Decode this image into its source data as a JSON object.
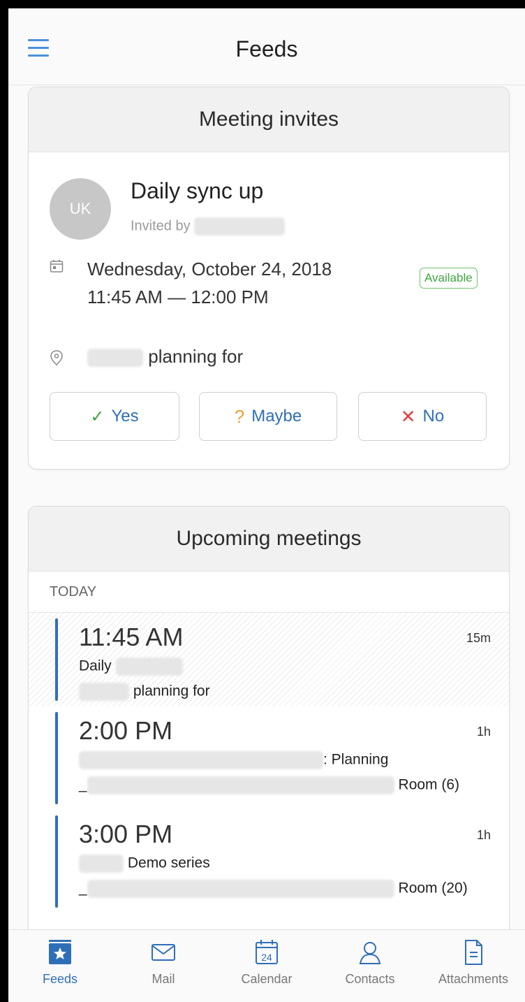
{
  "header": {
    "title": "Feeds"
  },
  "invites": {
    "section_title": "Meeting invites",
    "avatar_initials": "UK",
    "title": "Daily sync up",
    "invited_by": "Invited by",
    "date_line": "Wednesday, October 24, 2018",
    "time_line": "11:45 AM — 12:00 PM",
    "availability": "Available",
    "location_text": "planning for",
    "yes_label": "Yes",
    "maybe_label": "Maybe",
    "no_label": "No"
  },
  "upcoming": {
    "section_title": "Upcoming meetings",
    "day_label": "TODAY",
    "meetings": [
      {
        "time": "11:45 AM",
        "duration": "15m",
        "line1": "Daily",
        "line2": "planning for"
      },
      {
        "time": "2:00 PM",
        "duration": "1h",
        "line1": ": Planning",
        "line2_prefix": "_",
        "line2": "Room (6)"
      },
      {
        "time": "3:00 PM",
        "duration": "1h",
        "line1": "Demo series",
        "line2_prefix": "_",
        "line2": "Room (20)"
      }
    ]
  },
  "nav": {
    "items": [
      {
        "label": "Feeds",
        "icon": "feeds-star-icon"
      },
      {
        "label": "Mail",
        "icon": "mail-icon"
      },
      {
        "label": "Calendar",
        "icon": "calendar-icon",
        "icon_text": "24"
      },
      {
        "label": "Contacts",
        "icon": "contacts-icon"
      },
      {
        "label": "Attachments",
        "icon": "attachments-icon"
      }
    ]
  },
  "colors": {
    "accent": "#2f6fb8",
    "available": "#3fa63f",
    "decline": "#e04040",
    "maybe": "#f0a030"
  }
}
